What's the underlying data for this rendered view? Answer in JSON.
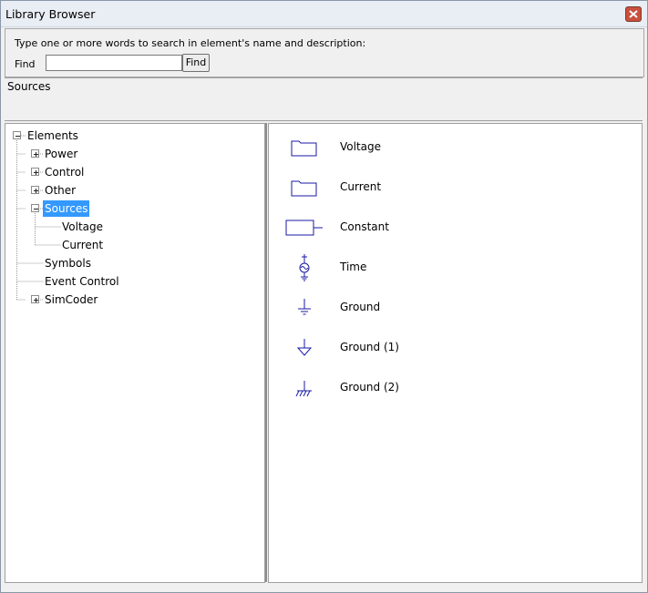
{
  "window": {
    "title": "Library Browser",
    "close_label": "×"
  },
  "search": {
    "hint": "Type one or more words to search in element's name and  description:",
    "find_label": "Find",
    "input_value": "",
    "button_label": "Find"
  },
  "path": {
    "text": "Sources"
  },
  "tree": {
    "root": "Elements",
    "items": [
      {
        "label": "Power",
        "state": "collapsed"
      },
      {
        "label": "Control",
        "state": "collapsed"
      },
      {
        "label": "Other",
        "state": "collapsed"
      },
      {
        "label": "Sources",
        "state": "expanded",
        "selected": true,
        "children": [
          {
            "label": "Voltage"
          },
          {
            "label": "Current"
          }
        ]
      },
      {
        "label": "Symbols",
        "state": "leaf"
      },
      {
        "label": "Event Control",
        "state": "leaf"
      },
      {
        "label": "SimCoder",
        "state": "collapsed"
      }
    ]
  },
  "list": {
    "items": [
      {
        "label": "Voltage",
        "icon": "folder-icon"
      },
      {
        "label": "Current",
        "icon": "folder-icon"
      },
      {
        "label": "Constant",
        "icon": "constant-source-icon"
      },
      {
        "label": "Time",
        "icon": "time-source-icon"
      },
      {
        "label": "Ground",
        "icon": "ground-icon"
      },
      {
        "label": "Ground (1)",
        "icon": "ground-arrow-icon"
      },
      {
        "label": "Ground (2)",
        "icon": "chassis-ground-icon"
      }
    ]
  },
  "colors": {
    "selection": "#3399ff",
    "icon_stroke": "#1a1aa6"
  }
}
